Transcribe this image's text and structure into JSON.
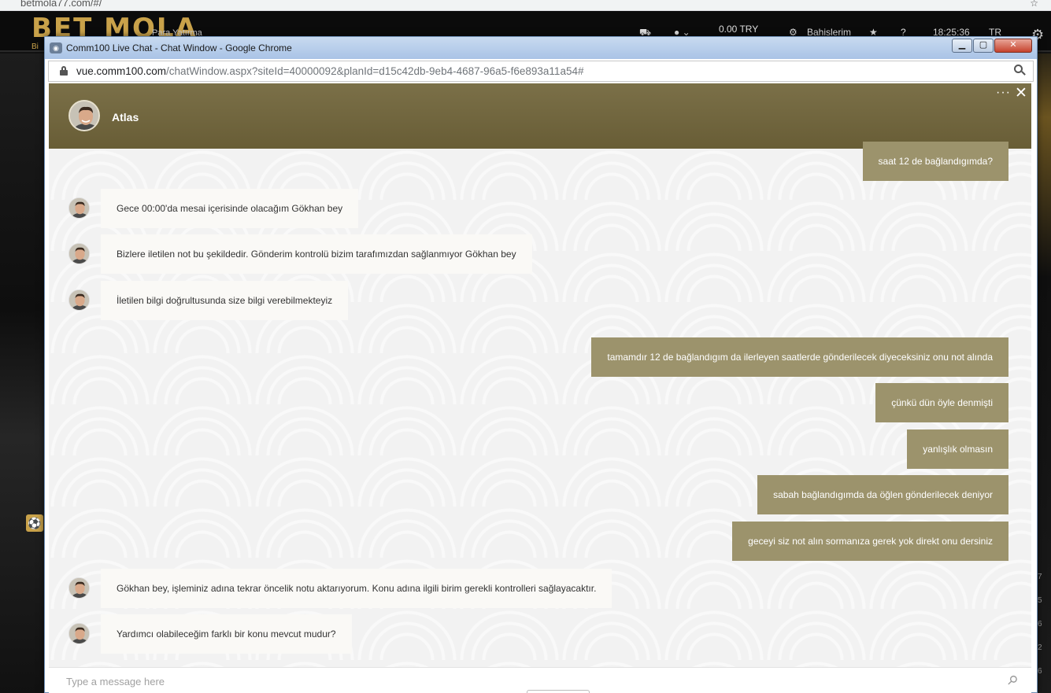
{
  "background": {
    "tab_url": "betmola77.com/#/",
    "logo": "BET MOLA",
    "logo_sub": "Bi",
    "nav_item": "Para Yatırma",
    "balance": "0.00 TRY",
    "bets_label": "Bahislerim",
    "clock": "18:25:36",
    "language": "TR",
    "side_numbers": [
      "7",
      "5",
      "6",
      "2",
      "6"
    ]
  },
  "window": {
    "title": "Comm100 Live Chat - Chat Window - Google Chrome",
    "url_host": "vue.comm100.com",
    "url_path": "/chatWindow.aspx?siteId=40000092&planId=d15c42db-9eb4-4687-96a5-f6e893a11a54#",
    "controls": {
      "minimize": "▁",
      "maximize": "▢",
      "close": "✕"
    }
  },
  "chat": {
    "agent_name": "Atlas",
    "messages": [
      {
        "from": "visitor",
        "text": "saat 12 de bağlandıgımda?"
      },
      {
        "from": "agent",
        "text": "Gece 00:00'da mesai içerisinde olacağım Gökhan bey"
      },
      {
        "from": "agent",
        "text": "Bizlere iletilen not bu şekildedir. Gönderim kontrolü bizim tarafımızdan sağlanmıyor Gökhan bey"
      },
      {
        "from": "agent",
        "text": "İletilen bilgi doğrultusunda size bilgi verebilmekteyiz"
      },
      {
        "from": "visitor",
        "text": "tamamdır 12 de bağlandıgım da ilerleyen saatlerde gönderilecek diyeceksiniz onu not alında"
      },
      {
        "from": "visitor",
        "text": "çünkü dün öyle denmişti"
      },
      {
        "from": "visitor",
        "text": "yanlışlık olmasın"
      },
      {
        "from": "visitor",
        "text": "sabah bağlandıgımda da öğlen gönderilecek deniyor"
      },
      {
        "from": "visitor",
        "text": "geceyi siz not alın sormanıza gerek yok direkt onu dersiniz"
      },
      {
        "from": "agent",
        "text": "Gökhan bey, işleminiz adına tekrar öncelik notu aktarıyorum. Konu adına ilgili birim gerekli kontrolleri sağlayacaktır."
      },
      {
        "from": "agent",
        "text": "Yardımcı olabileceğim farklı bir konu mevcut mudur?"
      }
    ],
    "composer_placeholder": "Type a message here"
  },
  "colors": {
    "header": "#6e6339",
    "visitor_bubble": "#9c936c",
    "agent_bubble": "#faf9f6"
  }
}
